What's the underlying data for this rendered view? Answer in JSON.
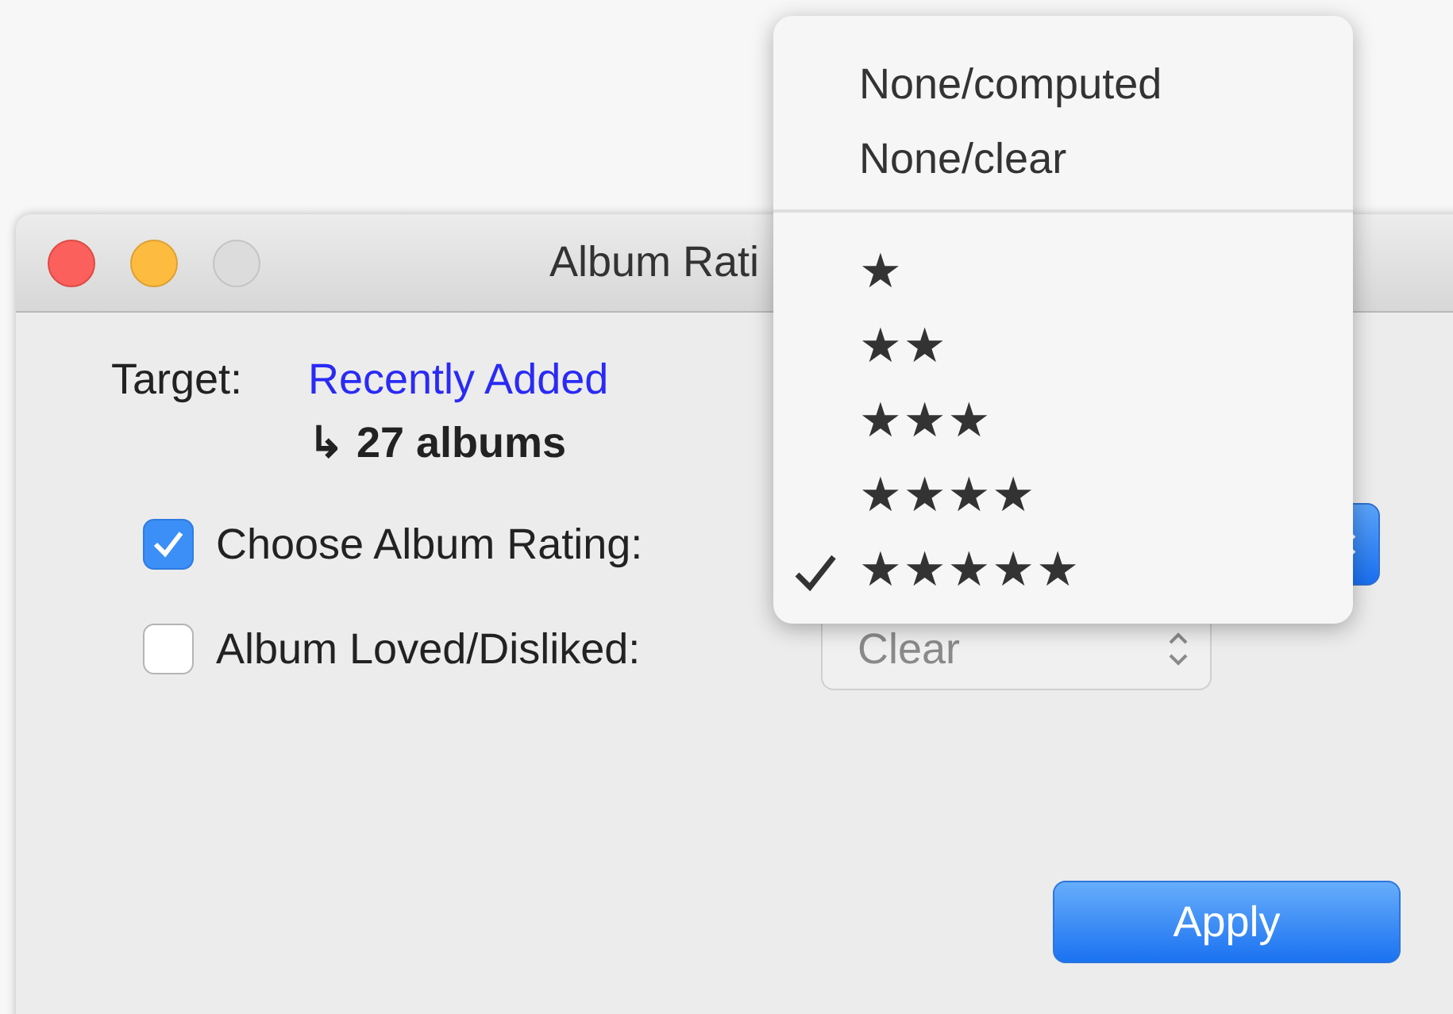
{
  "window": {
    "title": "Album Rati"
  },
  "target": {
    "label": "Target:",
    "value": "Recently Added",
    "count": "↳ 27 albums"
  },
  "options": [
    {
      "label": "Choose Album Rating:",
      "checked": true,
      "popup": {
        "disabled": false
      }
    },
    {
      "label": "Album Loved/Disliked:",
      "checked": false,
      "popup": {
        "value": "Clear",
        "disabled": true
      }
    }
  ],
  "apply_button": {
    "label": "Apply"
  },
  "menu": {
    "items": [
      {
        "kind": "text",
        "label": "None/computed",
        "selected": false
      },
      {
        "kind": "text",
        "label": "None/clear",
        "selected": false
      },
      {
        "kind": "separator"
      },
      {
        "kind": "rating",
        "label": "★",
        "selected": false
      },
      {
        "kind": "rating",
        "label": "★★",
        "selected": false
      },
      {
        "kind": "rating",
        "label": "★★★",
        "selected": false
      },
      {
        "kind": "rating",
        "label": "★★★★",
        "selected": false
      },
      {
        "kind": "rating",
        "label": "★★★★★",
        "selected": true
      }
    ]
  }
}
